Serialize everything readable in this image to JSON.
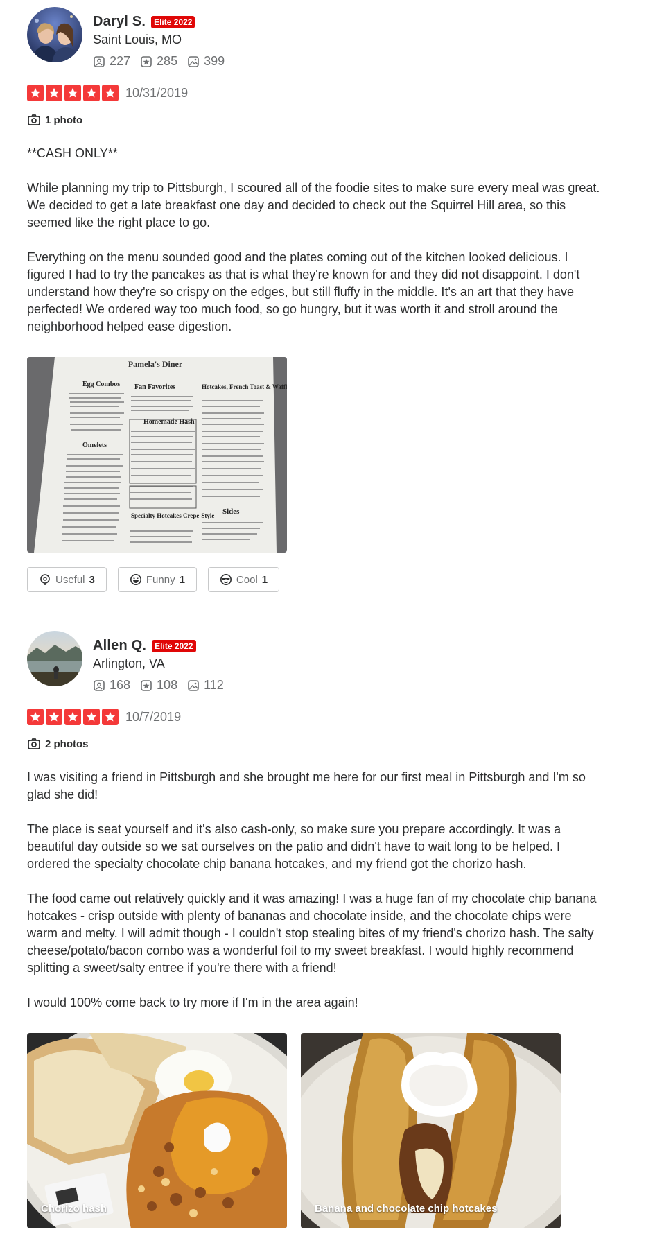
{
  "reviews": [
    {
      "name": "Daryl S.",
      "badge": "Elite 2022",
      "location": "Saint Louis, MO",
      "friends": "227",
      "reviews": "285",
      "photos": "399",
      "rating": 5,
      "date": "10/31/2019",
      "photos_label": "1 photo",
      "paragraphs": [
        "**CASH ONLY**",
        "While planning my trip to Pittsburgh, I scoured all of the foodie sites to make sure every meal was great. We decided to get a late breakfast one day and decided to check out the Squirrel Hill area, so this seemed like the right place to go.",
        "Everything on the menu sounded good and the plates coming out of the kitchen looked delicious. I figured I had to try the pancakes as that is what they're known for and they did not disappoint. I don't understand how they're so crispy on the edges, but still fluffy in the middle. It's an art that they have perfected! We ordered way too much food, so go hungry, but it was worth it and stroll around the neighborhood helped ease digestion."
      ],
      "menu_image": {
        "title": "Pamela's Diner",
        "sections": [
          "Egg Combos",
          "Fan Favorites",
          "Hotcakes, French Toast & Waffles",
          "Homemade Hash",
          "Omelets",
          "Specialty Hotcakes Crepe-Style",
          "Sides"
        ]
      },
      "useful_label": "Useful",
      "useful_count": "3",
      "funny_label": "Funny",
      "funny_count": "1",
      "cool_label": "Cool",
      "cool_count": "1"
    },
    {
      "name": "Allen Q.",
      "badge": "Elite 2022",
      "location": "Arlington, VA",
      "friends": "168",
      "reviews": "108",
      "photos": "112",
      "rating": 5,
      "date": "10/7/2019",
      "photos_label": "2 photos",
      "paragraphs": [
        "I was visiting a friend in Pittsburgh and she brought me here for our first meal in Pittsburgh and I'm so glad she did!",
        "The place is seat yourself and it's also cash-only, so make sure you prepare accordingly. It was a beautiful day outside so we sat ourselves on the patio and didn't have to wait long to be helped. I ordered the specialty chocolate chip banana hotcakes, and my friend got the chorizo hash.",
        "The food came out relatively quickly and it was amazing! I was a huge fan of my chocolate chip banana hotcakes - crisp outside with plenty of bananas and chocolate inside, and the chocolate chips were warm and melty. I will admit though - I couldn't stop stealing bites of my friend's chorizo hash. The salty cheese/potato/bacon combo was a wonderful foil to my sweet breakfast. I would highly recommend splitting a sweet/salty entree if you're there with a friend!",
        "I would 100% come back to try more if I'm in the area again!"
      ],
      "photo_captions": [
        "Chorizo hash",
        "Banana and chocolate chip hotcakes"
      ]
    }
  ],
  "colors": {
    "star_red": "#f43939",
    "elite_red": "#e00707",
    "text": "#2d2e2f",
    "muted": "#6e7072"
  }
}
